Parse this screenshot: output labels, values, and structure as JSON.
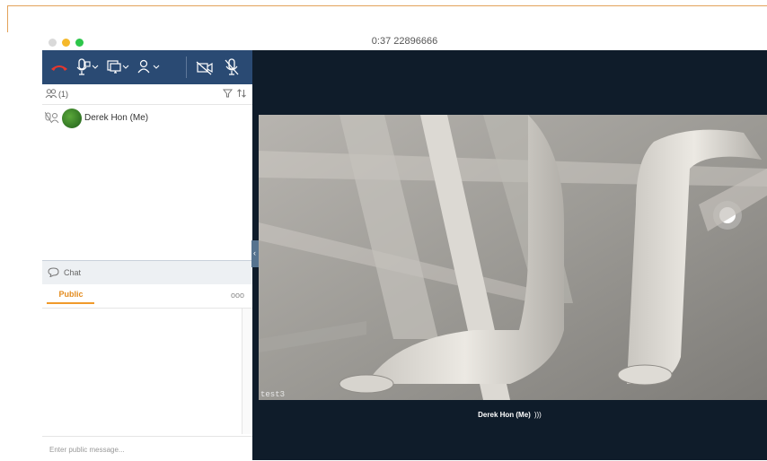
{
  "window": {
    "title": "0:37  22896666"
  },
  "participants": {
    "count_label": "(1)",
    "list": [
      {
        "name": "Derek Hon (Me)"
      }
    ]
  },
  "chat": {
    "header_label": "Chat",
    "tab_public": "Public",
    "more": "ooo",
    "input_placeholder": "Enter public message..."
  },
  "video": {
    "label": "test3",
    "speaker_name": "Derek Hon (Me)",
    "speaker_indicator": ")))"
  },
  "colors": {
    "toolbar_bg": "#2a4a73",
    "video_stage_bg": "#0f1c2a",
    "accent_orange": "#f09a2a",
    "hangup_red": "#e5372d"
  },
  "icons": [
    "hangup-icon",
    "microphone-icon",
    "screen-share-icon",
    "participants-icon",
    "camera-off-icon",
    "mic-off-icon",
    "filter-icon",
    "sort-icon",
    "chat-bubble-icon",
    "chevron-left-icon"
  ]
}
